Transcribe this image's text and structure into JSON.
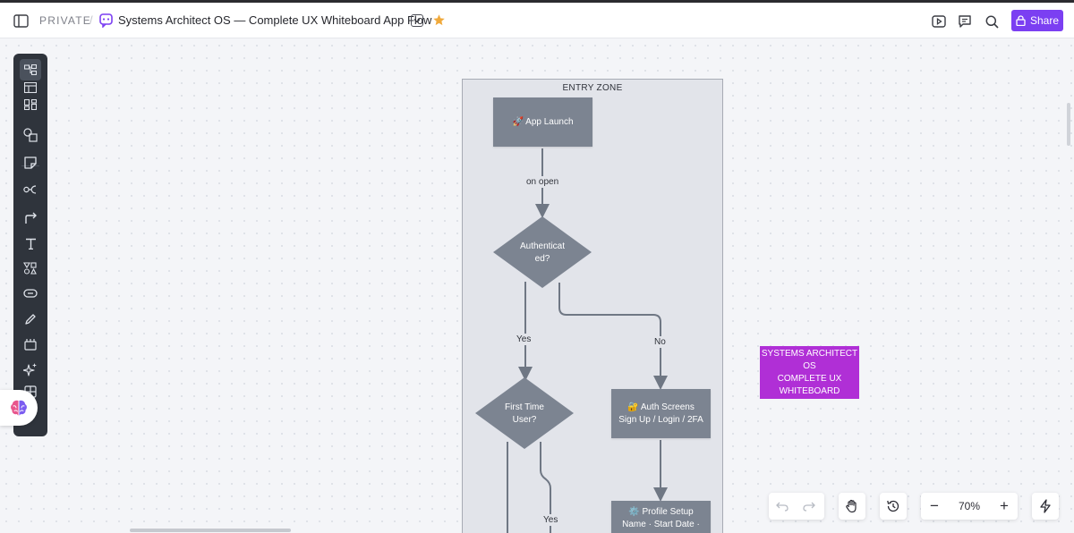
{
  "header": {
    "privacy": "PRIVATE",
    "separator": "/",
    "title": "Systems Architect OS — Complete UX Whiteboard App Flow",
    "share_label": "Share",
    "icons": [
      "sidebar-toggle-icon",
      "whiteboard-icon",
      "chevron-down-icon",
      "star-icon",
      "present-icon",
      "comment-icon",
      "search-icon",
      "lock-icon"
    ]
  },
  "toolbar": {
    "tools": [
      "diagram-tool",
      "table-tool",
      "kanban-tool",
      "shapes-tool",
      "sticky-note-tool",
      "mind-map-tool",
      "connector-tool",
      "text-tool",
      "templates-tool",
      "link-tool",
      "pen-tool",
      "frame-tool",
      "ai-sparkle-tool",
      "more-tool"
    ]
  },
  "diagram": {
    "zone_title": "ENTRY ZONE",
    "nodes": {
      "app_launch": "🚀 App Launch",
      "authenticated": [
        "Authenticat",
        "ed?"
      ],
      "first_time": [
        "First Time",
        "User?"
      ],
      "auth_screens": [
        "🔐 Auth Screens",
        "Sign Up / Login / 2FA"
      ],
      "profile_setup": [
        "⚙️ Profile Setup",
        "Name · Start Date ·"
      ]
    },
    "edges": {
      "on_open": "on open",
      "yes_1": "Yes",
      "no_1": "No",
      "yes_2": "Yes"
    }
  },
  "note": {
    "lines": [
      "SYSTEMS ARCHITECT",
      "OS",
      "COMPLETE UX",
      "WHITEBOARD"
    ]
  },
  "bottom_bar": {
    "zoom": "70%",
    "zoom_out": "−",
    "zoom_in": "+"
  },
  "colors": {
    "accent": "#7b3ff2",
    "node": "#7c8491",
    "note": "#b02fd6",
    "star": "#f0a93b"
  }
}
